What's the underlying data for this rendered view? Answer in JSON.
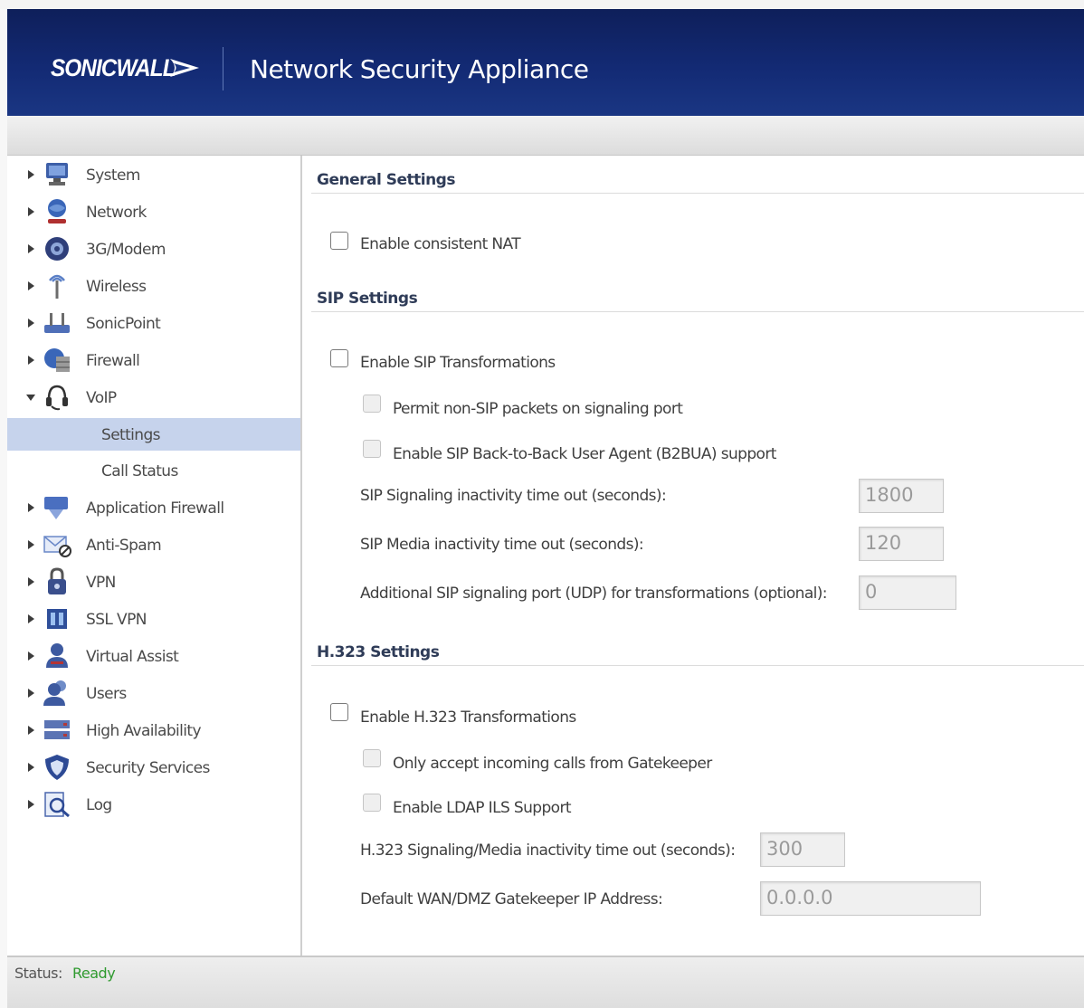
{
  "header": {
    "brand": "SONICWALL",
    "title": "Network Security Appliance"
  },
  "sidebar": {
    "items": [
      {
        "label": "System",
        "icon": "monitor-icon"
      },
      {
        "label": "Network",
        "icon": "globe-user-icon"
      },
      {
        "label": "3G/Modem",
        "icon": "modem-icon"
      },
      {
        "label": "Wireless",
        "icon": "antenna-icon"
      },
      {
        "label": "SonicPoint",
        "icon": "access-point-icon"
      },
      {
        "label": "Firewall",
        "icon": "firewall-icon"
      },
      {
        "label": "VoIP",
        "icon": "headset-icon"
      },
      {
        "label": "Settings"
      },
      {
        "label": "Call Status"
      },
      {
        "label": "Application Firewall",
        "icon": "app-firewall-icon"
      },
      {
        "label": "Anti-Spam",
        "icon": "anti-spam-icon"
      },
      {
        "label": "VPN",
        "icon": "lock-icon"
      },
      {
        "label": "SSL VPN",
        "icon": "ssl-vpn-icon"
      },
      {
        "label": "Virtual Assist",
        "icon": "assist-user-icon"
      },
      {
        "label": "Users",
        "icon": "users-icon"
      },
      {
        "label": "High Availability",
        "icon": "server-icon"
      },
      {
        "label": "Security Services",
        "icon": "shield-icon"
      },
      {
        "label": "Log",
        "icon": "magnifier-log-icon"
      }
    ]
  },
  "main": {
    "general": {
      "title": "General Settings",
      "consistent_nat_label": "Enable consistent NAT"
    },
    "sip": {
      "title": "SIP Settings",
      "enable_label": "Enable SIP Transformations",
      "permit_label": "Permit non-SIP packets on signaling port",
      "b2bua_label": "Enable SIP Back-to-Back User Agent (B2BUA) support",
      "signaling_timeout_label": "SIP Signaling inactivity time out (seconds):",
      "signaling_timeout_value": "1800",
      "media_timeout_label": "SIP Media inactivity time out (seconds):",
      "media_timeout_value": "120",
      "additional_port_label": "Additional SIP signaling port (UDP) for transformations (optional):",
      "additional_port_value": "0"
    },
    "h323": {
      "title": "H.323 Settings",
      "enable_label": "Enable H.323 Transformations",
      "gatekeeper_only_label": "Only accept incoming calls from Gatekeeper",
      "ldap_label": "Enable LDAP ILS Support",
      "timeout_label": "H.323 Signaling/Media inactivity time out (seconds):",
      "timeout_value": "300",
      "gatekeeper_ip_label": "Default WAN/DMZ Gatekeeper IP Address:",
      "gatekeeper_ip_value": "0.0.0.0"
    }
  },
  "status": {
    "label": "Status:",
    "value": "Ready"
  },
  "colors": {
    "header_blue": "#132a74",
    "selected_nav": "#c6d3ec",
    "status_ready": "#2f9a2f"
  }
}
